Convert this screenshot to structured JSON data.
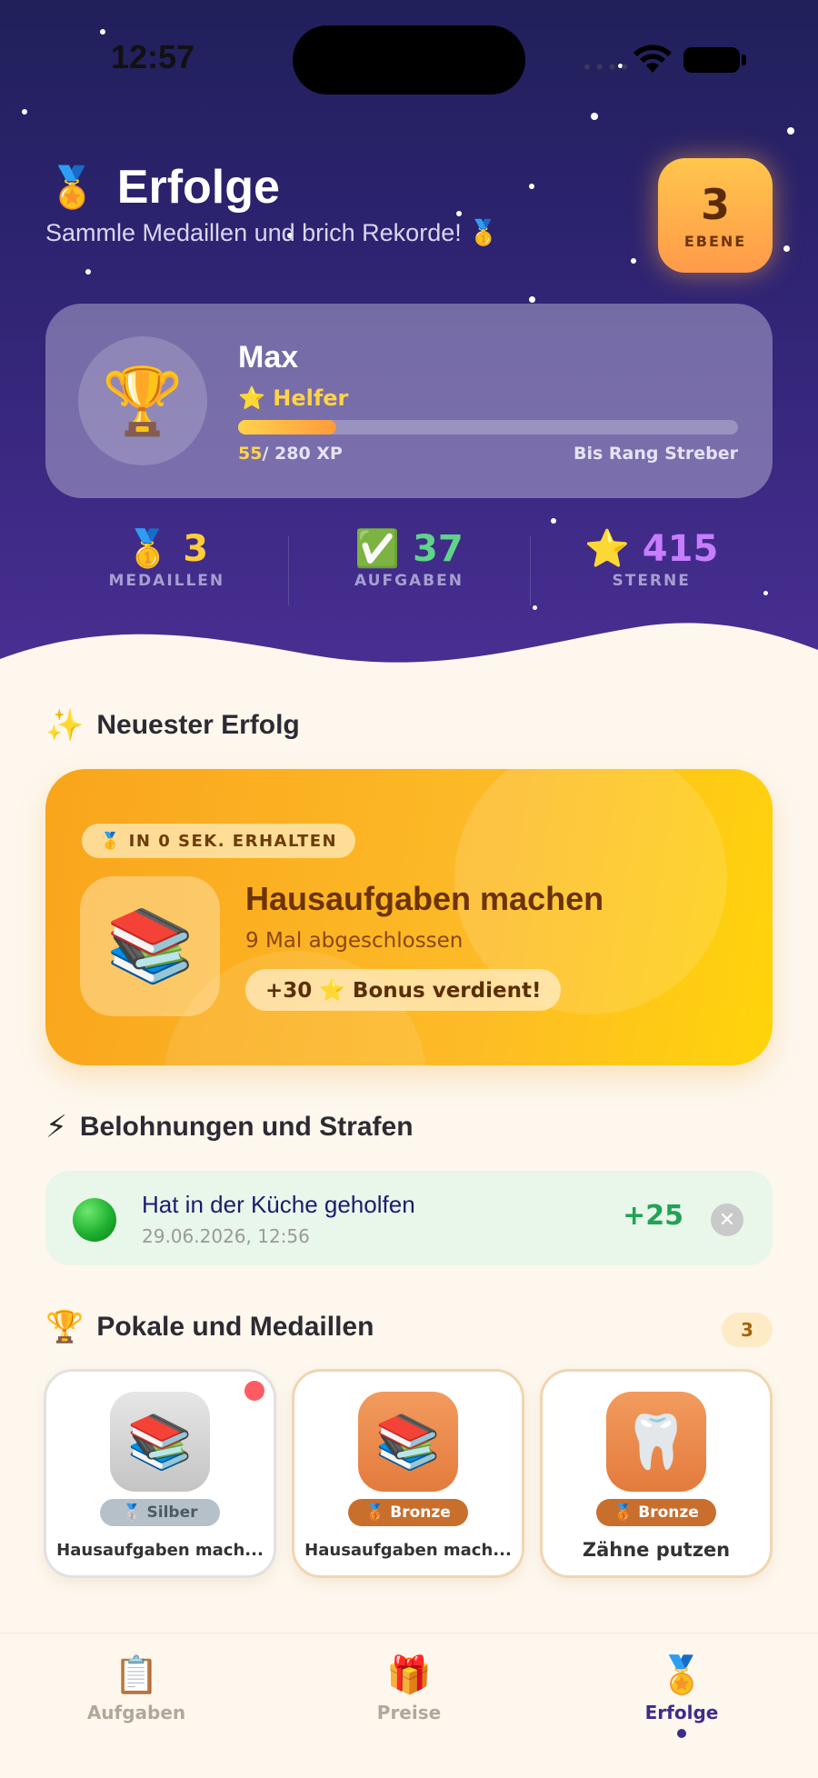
{
  "status_bar": {
    "time": "12:57"
  },
  "header": {
    "icon": "medal-ribbon-icon",
    "title": "Erfolge",
    "subtitle": "Sammle Medaillen und brich Rekorde! 🥇",
    "level": {
      "value": "3",
      "label": "EBENE"
    }
  },
  "profile": {
    "name": "Max",
    "rank": "⭐ Helfer",
    "xp_current": "55",
    "xp_total": "/ 280 XP",
    "xp_fraction": 0.196,
    "next_rank": "Bis Rang Streber"
  },
  "stats": [
    {
      "emoji": "🥇",
      "value": "3",
      "label": "MEDAILLEN",
      "color": "#ffcd3c"
    },
    {
      "emoji": "✅",
      "value": "37",
      "label": "AUFGABEN",
      "color": "#5fd38a"
    },
    {
      "emoji": "⭐",
      "value": "415",
      "label": "STERNE",
      "color": "#c77dff"
    }
  ],
  "latest": {
    "section_emoji": "✨",
    "section_title": "Neuester Erfolg",
    "pill": "🥇 IN 0 SEK. ERHALTEN",
    "icon": "📚",
    "name": "Hausaufgaben machen",
    "sub": "9 Mal abgeschlossen",
    "bonus": "+30 ⭐ Bonus verdient!"
  },
  "rewards": {
    "section_emoji": "⚡",
    "section_title": "Belohnungen und Strafen",
    "items": [
      {
        "title": "Hat in der Küche geholfen",
        "date": "29.06.2026, 12:56",
        "points": "+25",
        "close": "✕"
      }
    ]
  },
  "trophies": {
    "section_emoji": "🏆",
    "section_title": "Pokale und Medaillen",
    "count": "3",
    "items": [
      {
        "icon": "📚",
        "tier": "🥈 Silber",
        "name": "Hausaufgaben mach..."
      },
      {
        "icon": "📚",
        "tier": "🥉 Bronze",
        "name": "Hausaufgaben mach..."
      },
      {
        "icon": "🦷",
        "tier": "🥉 Bronze",
        "name": "Zähne putzen"
      }
    ]
  },
  "tabs": [
    {
      "icon": "📋",
      "label": "Aufgaben"
    },
    {
      "icon": "🎁",
      "label": "Preise"
    },
    {
      "icon": "🏅",
      "label": "Erfolge"
    }
  ]
}
